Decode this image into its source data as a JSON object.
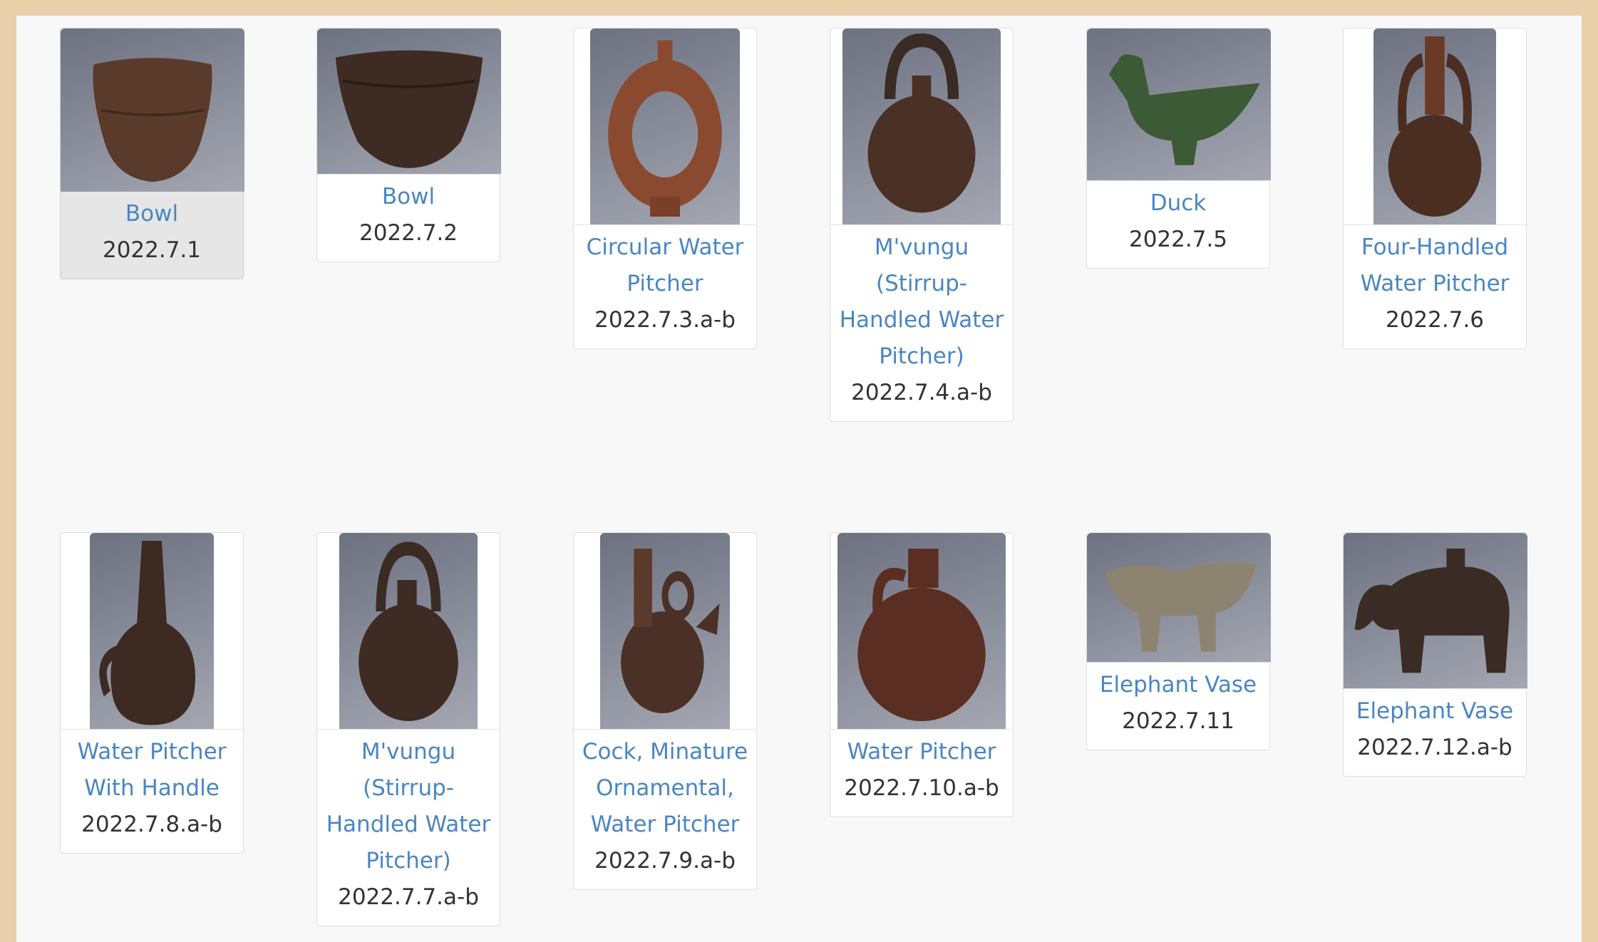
{
  "items": [
    {
      "title": "Bowl",
      "accession": "2022.7.1",
      "image": "bowl-photo"
    },
    {
      "title": "Bowl",
      "accession": "2022.7.2",
      "image": "bowl-photo"
    },
    {
      "title": "Circular Water Pitcher",
      "accession": "2022.7.3.a-b",
      "image": "ring-pitcher-photo"
    },
    {
      "title": "M'vungu (Stirrup-Handled Water Pitcher)",
      "accession": "2022.7.4.a-b",
      "image": "stirrup-pitcher-photo"
    },
    {
      "title": "Duck",
      "accession": "2022.7.5",
      "image": "duck-vessel-photo"
    },
    {
      "title": "Four-Handled Water Pitcher",
      "accession": "2022.7.6",
      "image": "four-handled-pitcher-photo"
    },
    {
      "title": "Water Pitcher With Handle",
      "accession": "2022.7.8.a-b",
      "image": "handled-pitcher-photo"
    },
    {
      "title": "M'vungu (Stirrup-Handled Water Pitcher)",
      "accession": "2022.7.7.a-b",
      "image": "stirrup-pitcher-photo"
    },
    {
      "title": "Cock, Minature Ornamental, Water Pitcher",
      "accession": "2022.7.9.a-b",
      "image": "cock-pitcher-photo"
    },
    {
      "title": "Water Pitcher",
      "accession": "2022.7.10.a-b",
      "image": "water-pitcher-photo"
    },
    {
      "title": "Elephant Vase",
      "accession": "2022.7.11",
      "image": "elephant-vase-photo"
    },
    {
      "title": "Elephant Vase",
      "accession": "2022.7.12.a-b",
      "image": "elephant-vase-photo"
    }
  ],
  "colors": {
    "frame": "#e9cfaa",
    "link": "#4a86c2",
    "text": "#333333",
    "selected": "#e6e6e6"
  }
}
